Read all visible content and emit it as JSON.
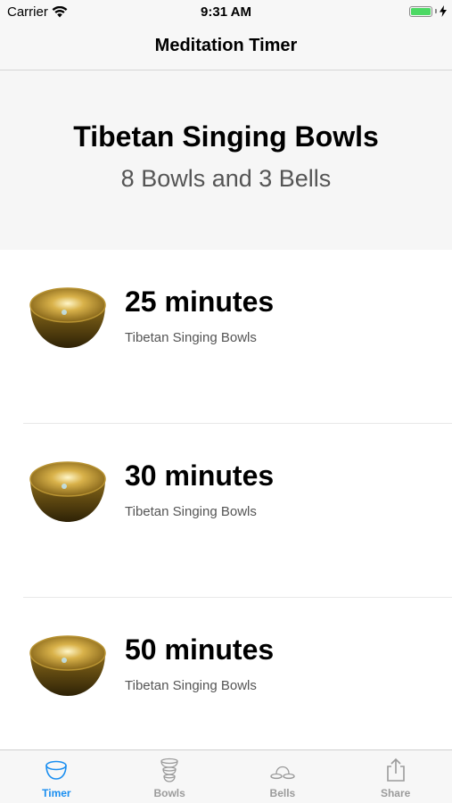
{
  "status": {
    "carrier": "Carrier",
    "time": "9:31 AM"
  },
  "nav": {
    "title": "Meditation Timer"
  },
  "header": {
    "title": "Tibetan Singing Bowls",
    "subtitle": "8 Bowls and 3 Bells"
  },
  "timers": [
    {
      "title": "25 minutes",
      "subtitle": "Tibetan Singing Bowls",
      "icon": "singing-bowl-icon"
    },
    {
      "title": "30 minutes",
      "subtitle": "Tibetan Singing Bowls",
      "icon": "singing-bowl-icon"
    },
    {
      "title": "50 minutes",
      "subtitle": "Tibetan Singing Bowls",
      "icon": "singing-bowl-icon"
    }
  ],
  "tabs": [
    {
      "label": "Timer",
      "icon": "timer-bowl-icon",
      "active": true
    },
    {
      "label": "Bowls",
      "icon": "bowls-stack-icon",
      "active": false
    },
    {
      "label": "Bells",
      "icon": "bells-icon",
      "active": false
    },
    {
      "label": "Share",
      "icon": "share-icon",
      "active": false
    }
  ],
  "colors": {
    "accent": "#1a8ef0",
    "inactive_tab": "#9b9b9b",
    "battery": "#4cd964",
    "header_bg": "#f6f6f6"
  }
}
